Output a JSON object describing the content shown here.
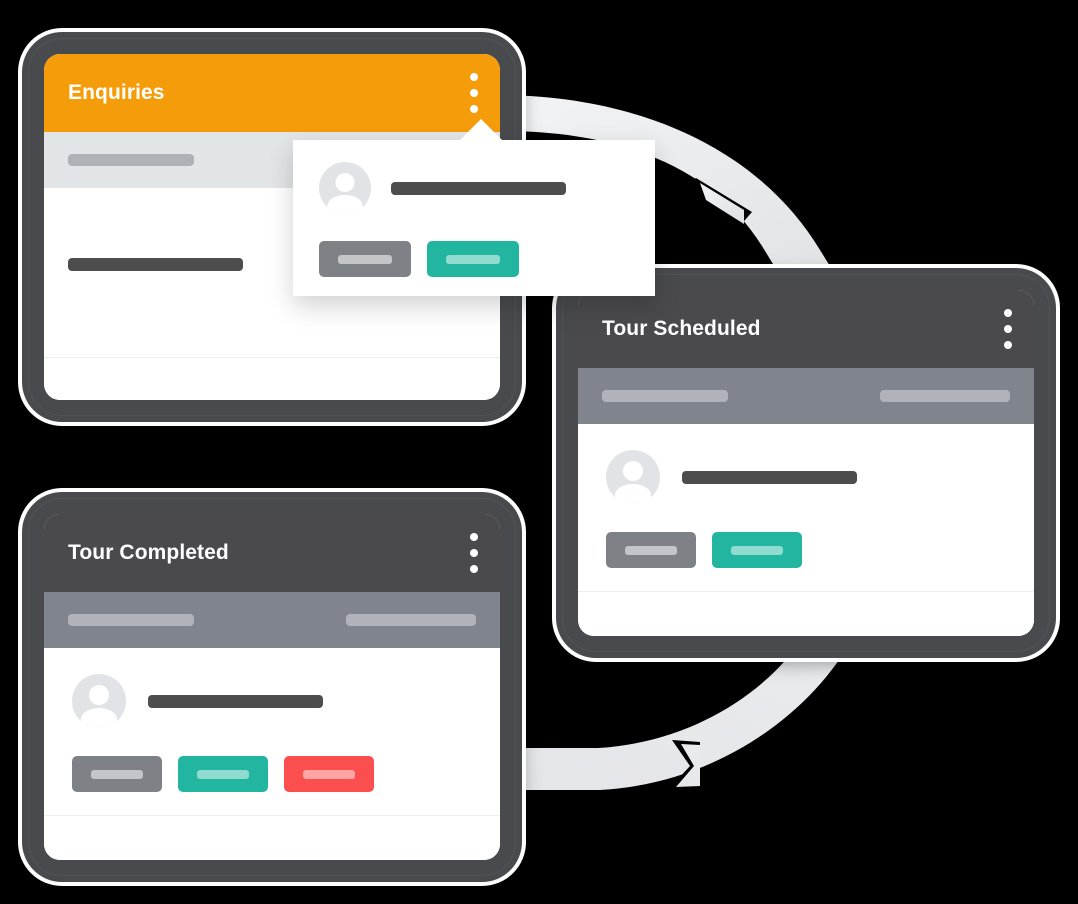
{
  "illustration": {
    "title": "Tour workflow lifecycle",
    "background_color": "#000000"
  },
  "palette": {
    "orange": "#F59C0B",
    "dark_header": "#4A4A4D",
    "bezel": "#484A4D",
    "subheader_light": "#E2E5E7",
    "subheader_gray": "#80848D",
    "teal": "#22B5A0",
    "red": "#FB4E4E",
    "gray_button": "#7E8186",
    "arc": "#E9EAEC",
    "placeholder_dark": "#4D4D4D",
    "avatar": "#E1E3E6"
  },
  "cards": [
    {
      "id": "enquiries",
      "title": "Enquiries",
      "header_style": "orange",
      "subheader_style": "light",
      "kebab_label": "More options",
      "placeholders": {
        "subheader_bars": 1,
        "body_lines": 1
      },
      "buttons": []
    },
    {
      "id": "tour-scheduled",
      "title": "Tour Scheduled",
      "header_style": "dark",
      "subheader_style": "gray",
      "kebab_label": "More options",
      "placeholders": {
        "subheader_bars": 2,
        "body_lines": 1
      },
      "buttons": [
        {
          "name": "secondary-action",
          "color": "gray"
        },
        {
          "name": "confirm-action",
          "color": "teal"
        }
      ]
    },
    {
      "id": "tour-completed",
      "title": "Tour Completed",
      "header_style": "dark",
      "subheader_style": "gray",
      "kebab_label": "More options",
      "placeholders": {
        "subheader_bars": 2,
        "body_lines": 1
      },
      "buttons": [
        {
          "name": "secondary-action",
          "color": "gray"
        },
        {
          "name": "confirm-action",
          "color": "teal"
        },
        {
          "name": "delete-action",
          "color": "red"
        }
      ]
    }
  ],
  "popup": {
    "id": "enquiries-context-popup",
    "anchor": "enquiries-kebab-menu",
    "avatar_label": "Contact avatar",
    "buttons": [
      {
        "name": "secondary-action",
        "color": "gray"
      },
      {
        "name": "confirm-action",
        "color": "teal"
      }
    ]
  },
  "flow_arrow": {
    "name": "circular-workflow-arrow",
    "color": "#E9EAEC",
    "direction": "clockwise",
    "segments": 2
  }
}
